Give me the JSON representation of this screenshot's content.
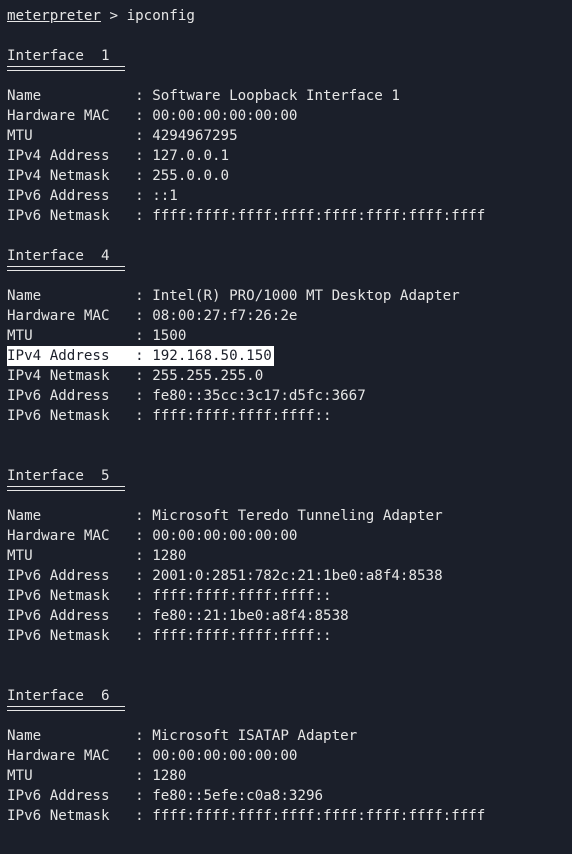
{
  "prompt": {
    "shell": "meterpreter",
    "separator": " > ",
    "command": "ipconfig"
  },
  "interfaces": [
    {
      "title": "Interface  1",
      "rows": [
        {
          "label": "Name           ",
          "value": ": Software Loopback Interface 1"
        },
        {
          "label": "Hardware MAC   ",
          "value": ": 00:00:00:00:00:00"
        },
        {
          "label": "MTU            ",
          "value": ": 4294967295"
        },
        {
          "label": "IPv4 Address   ",
          "value": ": 127.0.0.1"
        },
        {
          "label": "IPv4 Netmask   ",
          "value": ": 255.0.0.0"
        },
        {
          "label": "IPv6 Address   ",
          "value": ": ::1"
        },
        {
          "label": "IPv6 Netmask   ",
          "value": ": ffff:ffff:ffff:ffff:ffff:ffff:ffff:ffff"
        }
      ]
    },
    {
      "title": "Interface  4",
      "rows": [
        {
          "label": "Name           ",
          "value": ": Intel(R) PRO/1000 MT Desktop Adapter"
        },
        {
          "label": "Hardware MAC   ",
          "value": ": 08:00:27:f7:26:2e"
        },
        {
          "label": "MTU            ",
          "value": ": 1500"
        },
        {
          "label": "IPv4 Address   ",
          "value": ": 192.168.50.150",
          "highlighted": true
        },
        {
          "label": "IPv4 Netmask   ",
          "value": ": 255.255.255.0"
        },
        {
          "label": "IPv6 Address   ",
          "value": ": fe80::35cc:3c17:d5fc:3667"
        },
        {
          "label": "IPv6 Netmask   ",
          "value": ": ffff:ffff:ffff:ffff::"
        }
      ]
    },
    {
      "title": "Interface  5",
      "rows": [
        {
          "label": "Name           ",
          "value": ": Microsoft Teredo Tunneling Adapter"
        },
        {
          "label": "Hardware MAC   ",
          "value": ": 00:00:00:00:00:00"
        },
        {
          "label": "MTU            ",
          "value": ": 1280"
        },
        {
          "label": "IPv6 Address   ",
          "value": ": 2001:0:2851:782c:21:1be0:a8f4:8538"
        },
        {
          "label": "IPv6 Netmask   ",
          "value": ": ffff:ffff:ffff:ffff::"
        },
        {
          "label": "IPv6 Address   ",
          "value": ": fe80::21:1be0:a8f4:8538"
        },
        {
          "label": "IPv6 Netmask   ",
          "value": ": ffff:ffff:ffff:ffff::"
        }
      ]
    },
    {
      "title": "Interface  6",
      "rows": [
        {
          "label": "Name           ",
          "value": ": Microsoft ISATAP Adapter"
        },
        {
          "label": "Hardware MAC   ",
          "value": ": 00:00:00:00:00:00"
        },
        {
          "label": "MTU            ",
          "value": ": 1280"
        },
        {
          "label": "IPv6 Address   ",
          "value": ": fe80::5efe:c0a8:3296"
        },
        {
          "label": "IPv6 Netmask   ",
          "value": ": ffff:ffff:ffff:ffff:ffff:ffff:ffff:ffff"
        }
      ]
    }
  ]
}
